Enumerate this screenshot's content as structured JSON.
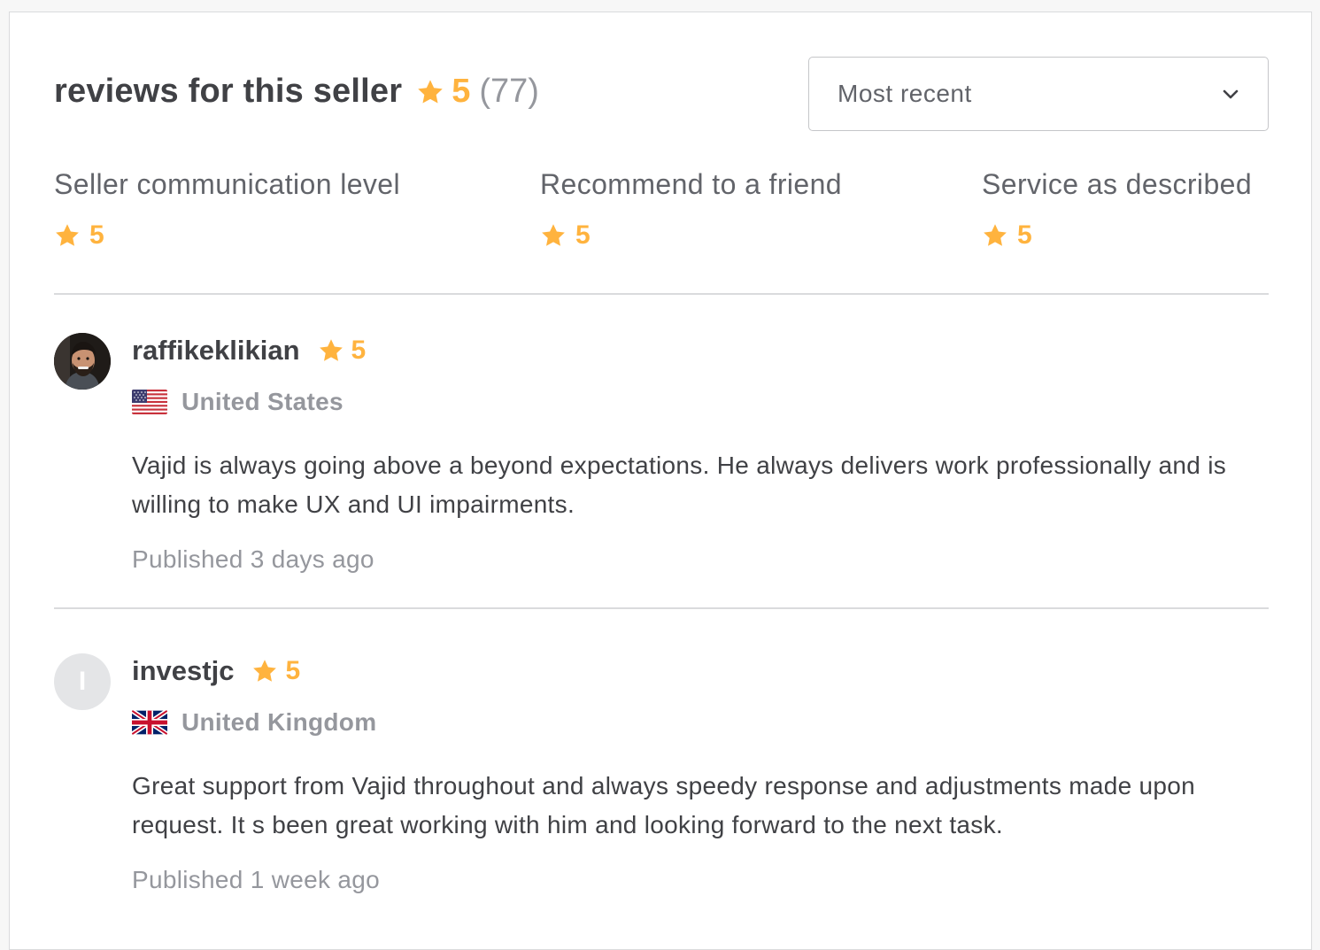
{
  "header": {
    "title": "reviews for this seller",
    "score": "5",
    "count": "(77)"
  },
  "sort": {
    "selected": "Most recent",
    "icon": "chevron-down-icon"
  },
  "breakdown": [
    {
      "label": "Seller communication level",
      "score": "5"
    },
    {
      "label": "Recommend to a friend",
      "score": "5"
    },
    {
      "label": "Service as described",
      "score": "5"
    }
  ],
  "reviews": [
    {
      "username": "raffikeklikian",
      "score": "5",
      "country": "United States",
      "flag": "us-flag-icon",
      "text": "Vajid is always going above a beyond expectations. He always delivers work professionally and is willing to make UX and UI impairments.",
      "published": "Published 3 days ago"
    },
    {
      "username": "investjc",
      "avatar_initial": "I",
      "score": "5",
      "country": "United Kingdom",
      "flag": "uk-flag-icon",
      "text": "Great support from Vajid throughout and always speedy response and adjustments made upon request. It s been great working with him and looking forward to the next task.",
      "published": "Published 1 week ago"
    }
  ],
  "colors": {
    "star": "#ffb33e",
    "text": "#404145",
    "muted": "#95979d",
    "divider": "#dadbdd"
  }
}
